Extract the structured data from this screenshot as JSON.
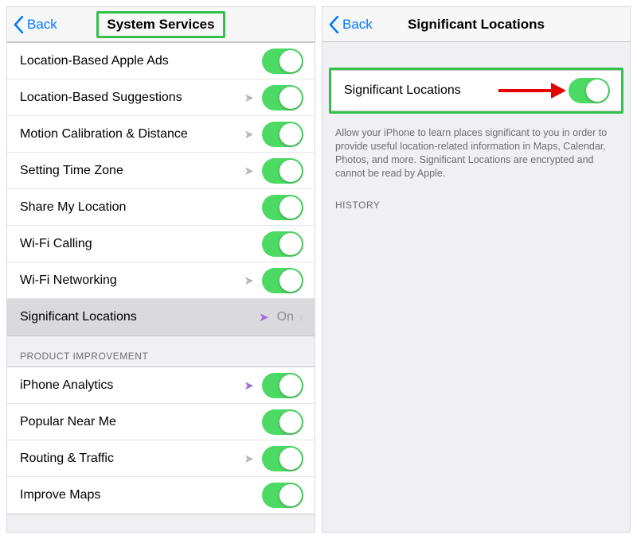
{
  "left": {
    "back": "Back",
    "title": "System Services",
    "rows": [
      {
        "label": "Location-Based Apple Ads",
        "loc": false,
        "toggle": true
      },
      {
        "label": "Location-Based Suggestions",
        "loc": true,
        "toggle": true
      },
      {
        "label": "Motion Calibration & Distance",
        "loc": true,
        "toggle": true
      },
      {
        "label": "Setting Time Zone",
        "loc": true,
        "toggle": true
      },
      {
        "label": "Share My Location",
        "loc": false,
        "toggle": true
      },
      {
        "label": "Wi-Fi Calling",
        "loc": false,
        "toggle": true
      },
      {
        "label": "Wi-Fi Networking",
        "loc": true,
        "toggle": true
      }
    ],
    "sig_loc": {
      "label": "Significant Locations",
      "value": "On"
    },
    "section2": "PRODUCT IMPROVEMENT",
    "rows2": [
      {
        "label": "iPhone Analytics",
        "loc": true,
        "locPurple": true,
        "toggle": true
      },
      {
        "label": "Popular Near Me",
        "loc": false,
        "toggle": true
      },
      {
        "label": "Routing & Traffic",
        "loc": true,
        "toggle": true
      },
      {
        "label": "Improve Maps",
        "loc": false,
        "toggle": true
      }
    ]
  },
  "right": {
    "back": "Back",
    "title": "Significant Locations",
    "row": {
      "label": "Significant Locations"
    },
    "note": "Allow your iPhone to learn places significant to you in order to provide useful location-related information in Maps, Calendar, Photos, and more. Significant Locations are encrypted and cannot be read by Apple.",
    "history": "HISTORY"
  }
}
